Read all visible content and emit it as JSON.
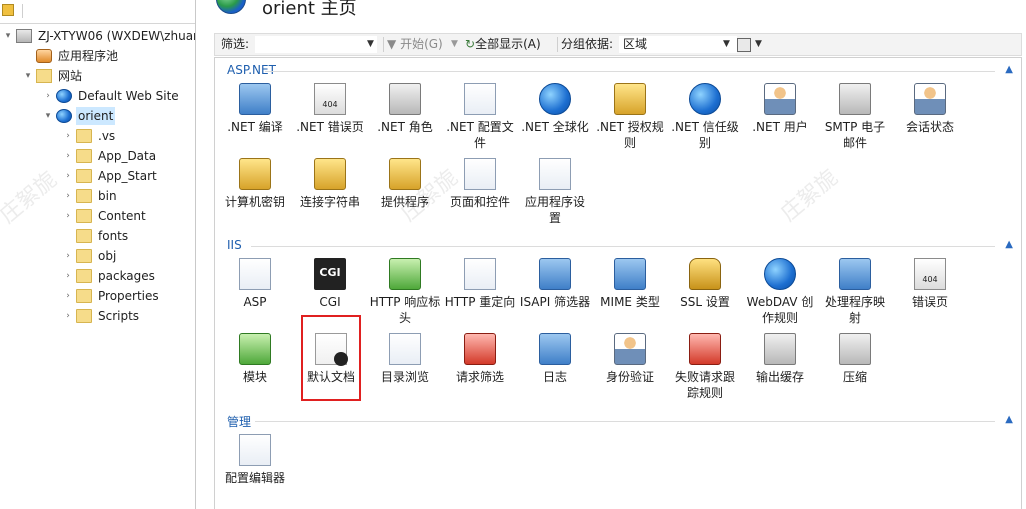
{
  "tree": {
    "server": "ZJ-XTYW06 (WXDEW\\zhuan",
    "app_pools": "应用程序池",
    "sites": "网站",
    "default_site": "Default Web Site",
    "orient": "orient",
    "children": [
      ".vs",
      "App_Data",
      "App_Start",
      "bin",
      "Content",
      "fonts",
      "obj",
      "packages",
      "Properties",
      "Scripts"
    ]
  },
  "header": {
    "title": "orient 主页"
  },
  "filterbar": {
    "filter_label": "筛选:",
    "start_label": "开始(G)",
    "show_all_label": "全部显示(A)",
    "group_label": "分组依据:",
    "group_value": "区域"
  },
  "groups": {
    "aspnet": {
      "title": "ASP.NET",
      "items": [
        ".NET 编译",
        ".NET 错误页",
        ".NET 角色",
        ".NET 配置文\n件",
        ".NET 全球化",
        ".NET 授权规\n则",
        ".NET 信任级\n别",
        ".NET 用户",
        "SMTP 电子\n邮件",
        "会话状态",
        "计算机密钥",
        "连接字符串",
        "提供程序",
        "页面和控件",
        "应用程序设\n置"
      ]
    },
    "iis": {
      "title": "IIS",
      "items": [
        "ASP",
        "CGI",
        "HTTP 响应标\n头",
        "HTTP 重定向",
        "ISAPI 筛选器",
        "MIME 类型",
        "SSL 设置",
        "WebDAV 创\n作规则",
        "处理程序映\n射",
        "错误页",
        "模块",
        "默认文档",
        "目录浏览",
        "请求筛选",
        "日志",
        "身份验证",
        "失败请求跟\n踪规则",
        "输出缓存",
        "压缩"
      ]
    },
    "mgmt": {
      "title": "管理",
      "items": [
        "配置编辑器"
      ]
    }
  },
  "icon_text": {
    "cgi": "CGI",
    "e404": "404"
  },
  "watermark": "庄絮旎"
}
